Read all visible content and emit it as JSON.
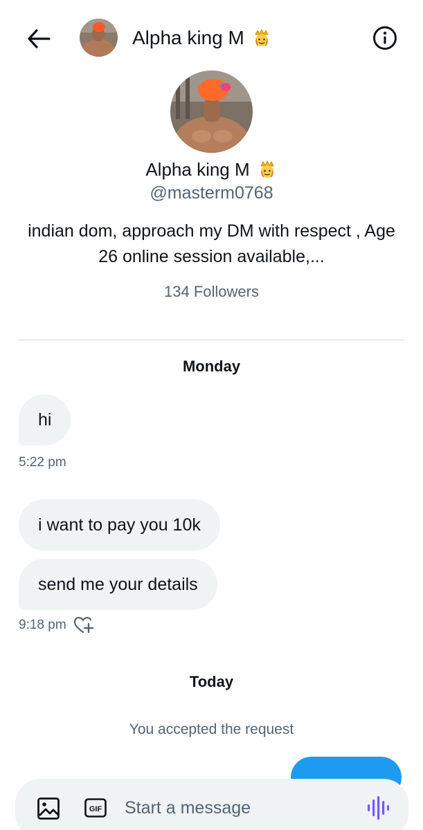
{
  "header": {
    "name": "Alpha king M"
  },
  "profile": {
    "name": "Alpha king M",
    "handle": "@masterm0768",
    "bio": "indian dom, approach my DM with respect , Age 26 online session available,...",
    "followers": "134 Followers"
  },
  "conversation": {
    "day1": "Monday",
    "messages_group1": [
      {
        "text": "hi"
      }
    ],
    "time1": "5:22 pm",
    "messages_group2": [
      {
        "text": "i want to pay you 10k"
      },
      {
        "text": "send me your details"
      }
    ],
    "time2": "9:18 pm",
    "day2": "Today",
    "system_note": "You accepted the request"
  },
  "composer": {
    "placeholder": "Start a message",
    "gif_label": "GIF"
  },
  "colors": {
    "accent": "#1d9bf0",
    "voice": "#7856ff",
    "bubble": "#eff3f4",
    "secondary_text": "#536471"
  },
  "icons": [
    "back-arrow-icon",
    "info-icon",
    "crown-emoji-icon",
    "add-reaction-icon",
    "image-icon",
    "gif-icon",
    "voice-wave-icon"
  ]
}
